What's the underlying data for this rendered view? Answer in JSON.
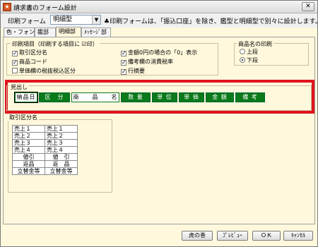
{
  "window": {
    "title": "請求書のフォーム設計",
    "close": "✕"
  },
  "form_select": {
    "label": "印刷フォーム",
    "value": "明細型"
  },
  "note": "♣印刷フォームは、「振込口座」を除き、鑑型と明細型で別々に設計します。",
  "tabs": [
    "色・フォント",
    "鑑部",
    "明細部",
    "ﾒｯｾｰｼﾞ部"
  ],
  "print_items": {
    "title": "印刷項目（印刷する項目に ☑印）",
    "left": [
      {
        "label": "取引区分名",
        "checked": true
      },
      {
        "label": "商品コード",
        "checked": true
      },
      {
        "label": "単価欄の税抜税込区分",
        "checked": false
      }
    ],
    "right": [
      {
        "label": "金額0円の場合の「0」表示",
        "checked": true
      },
      {
        "label": "備考欄の消費税率",
        "checked": true
      },
      {
        "label": "行摘要",
        "checked": true
      }
    ]
  },
  "product_print": {
    "title": "商品名の印刷",
    "options": [
      {
        "label": "上段",
        "selected": false
      },
      {
        "label": "下段",
        "selected": true
      }
    ]
  },
  "heading": {
    "title": "見出し",
    "cells": [
      "納品日",
      "区　分",
      "商　　品　　名",
      "数 量",
      "単 位",
      "単 価",
      "金 額",
      "備 考"
    ]
  },
  "kubun": {
    "title": "取引区分名",
    "rows": [
      [
        "売上１",
        "売上１"
      ],
      [
        "売上２",
        "売上２"
      ],
      [
        "売上３",
        "売上３"
      ],
      [
        "売上４",
        "売上４"
      ],
      [
        "値引",
        "値　引"
      ],
      [
        "返品",
        "返　品"
      ],
      [
        "立替金等",
        "立替金等"
      ]
    ]
  },
  "buttons": {
    "book": "虎の巻",
    "preview": "ﾌﾟﾚﾋﾞｭｰ",
    "ok": "ＯＫ",
    "cancel": "ｷｬﾝｾﾙ"
  },
  "colors": {
    "accent_red": "#e0141e",
    "cell_green": "#0a7a1a",
    "panel_bg": "#fff8dc"
  },
  "icons": {
    "app": "app-icon",
    "close": "close-icon",
    "dropdown": "chevron-down-icon"
  }
}
